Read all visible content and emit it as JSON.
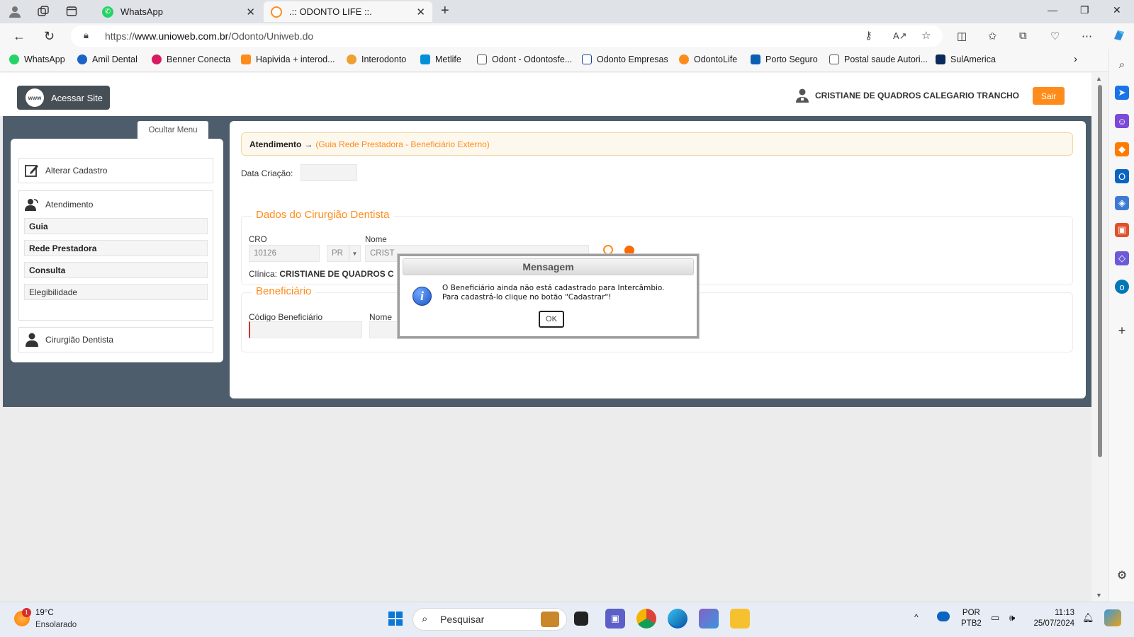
{
  "browser": {
    "tabs": [
      {
        "title": "WhatsApp",
        "active": false
      },
      {
        "title": ".:: ODONTO LIFE ::.",
        "active": true
      }
    ],
    "address": {
      "prefix": "https://",
      "host": "www.unioweb.com.br",
      "path": "/Odonto/Uniweb.do"
    },
    "bookmarks": [
      {
        "label": "WhatsApp",
        "icon": "whatsapp-icon",
        "color": "#25d366"
      },
      {
        "label": "Amil Dental",
        "icon": "amil-icon",
        "color": "#1b63c6"
      },
      {
        "label": "Benner Conecta",
        "icon": "benner-icon",
        "color": "#d81b60"
      },
      {
        "label": "Hapivida + interod...",
        "icon": "hapvida-icon",
        "color": "#ff8c1a"
      },
      {
        "label": "Interodonto",
        "icon": "interodonto-icon",
        "color": "#f0a030"
      },
      {
        "label": "Metlife",
        "icon": "metlife-icon",
        "color": "#0090da"
      },
      {
        "label": "Odont - Odontosfe...",
        "icon": "page-icon",
        "color": "#666666"
      },
      {
        "label": "Odonto Empresas",
        "icon": "tooth-icon",
        "color": "#1b3f8f"
      },
      {
        "label": "OdontoLife",
        "icon": "odontolife-icon",
        "color": "#ff8c1a"
      },
      {
        "label": "Porto Seguro",
        "icon": "porto-icon",
        "color": "#0a5fb4"
      },
      {
        "label": "Postal saude Autori...",
        "icon": "page-icon",
        "color": "#666666"
      },
      {
        "label": "SulAmerica",
        "icon": "sulamerica-icon",
        "color": "#0a2a5c"
      }
    ]
  },
  "header": {
    "site_button": "Acessar Site",
    "www_icon_text": "www",
    "user_name": "CRISTIANE DE QUADROS CALEGARIO TRANCHO",
    "logout": "Sair"
  },
  "sidebar": {
    "hide_menu": "Ocultar Menu",
    "alterar": "Alterar Cadastro",
    "atendimento": "Atendimento",
    "sub_items": [
      "Guia",
      "Rede Prestadora",
      "Consulta",
      "Elegibilidade"
    ],
    "cirurgiao": "Cirurgião Dentista"
  },
  "content": {
    "breadcrumb_main": "Atendimento",
    "breadcrumb_arrow": "→",
    "breadcrumb_sub": "(Guia Rede Prestadora - Beneficiário Externo)",
    "data_criacao_label": "Data Criação:",
    "dentist_legend": "Dados do Cirurgião Dentista",
    "cro_label": "CRO",
    "cro_value": "10126",
    "uf_value": "PR",
    "nome_label": "Nome",
    "nome_value": "CRIST",
    "clinica_label": "Clínica:",
    "clinica_value": "CRISTIANE DE QUADROS C",
    "beneficiario_legend": "Beneficiário",
    "codigo_label": "Código Beneficiário",
    "nome_benef_label": "Nome"
  },
  "modal": {
    "title": "Mensagem",
    "line1": "O Beneficiário ainda não está cadastrado para Intercâmbio.",
    "line2": "Para cadastrá-lo clique no botão \"Cadastrar\"!",
    "ok": "OK"
  },
  "taskbar": {
    "weather_badge": "1",
    "temperature": "19°C",
    "weather": "Ensolarado",
    "search_placeholder": "Pesquisar",
    "lang1": "POR",
    "lang2": "PTB2",
    "time": "11:13",
    "date": "25/07/2024"
  },
  "colors": {
    "accent": "#ff8c1a",
    "band": "#4e5d6c",
    "site_button": "#464e56"
  }
}
